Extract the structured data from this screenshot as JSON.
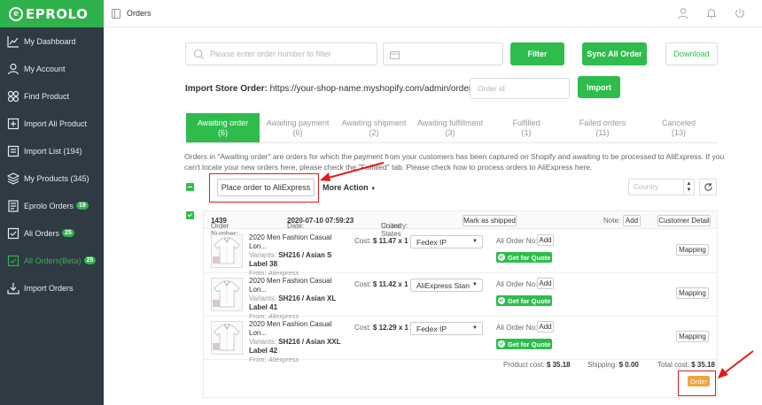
{
  "brand": {
    "logo_text": "EPROLO"
  },
  "header": {
    "title": "Orders"
  },
  "sidebar": {
    "items": [
      {
        "label": "My Dashboard",
        "icon": "chart-icon"
      },
      {
        "label": "My Account",
        "icon": "user-icon"
      },
      {
        "label": "Find Product",
        "icon": "grid-icon"
      },
      {
        "label": "Import Ali Product",
        "icon": "import-icon"
      },
      {
        "label": "Import List (194)",
        "icon": "list-icon"
      },
      {
        "label": "My Products (345)",
        "icon": "layers-icon"
      },
      {
        "label": "Eprolo Orders",
        "badge": "19",
        "icon": "document-icon"
      },
      {
        "label": "Ali Orders",
        "badge": "25",
        "icon": "checkbox-icon"
      },
      {
        "label": "All Orders(Beta)",
        "badge": "25",
        "icon": "checkbox-icon",
        "active": true
      },
      {
        "label": "Import Orders",
        "icon": "download-icon"
      }
    ]
  },
  "filters": {
    "order_search_placeholder": "Please enter order number to filter",
    "filter_label": "Filter",
    "sync_label": "Sync All Order",
    "download_label": "Download"
  },
  "import_store": {
    "label": "Import Store Order:",
    "url": "https://your-shop-name.myshopify.com/admin/orders/",
    "order_id_placeholder": "Order id",
    "import_label": "Import"
  },
  "tabs": [
    {
      "label": "Awaiting order",
      "count": "(6)",
      "active": true
    },
    {
      "label": "Awaiting payment",
      "count": "(6)"
    },
    {
      "label": "Awaiting shipment",
      "count": "(2)"
    },
    {
      "label": "Awaiting fulfillment",
      "count": "(3)"
    },
    {
      "label": "Fulfilled",
      "count": "(1)"
    },
    {
      "label": "Failed orders",
      "count": "(11)"
    },
    {
      "label": "Canceled",
      "count": "(13)"
    }
  ],
  "info_text": "Orders in \"Awaiting order\" are orders for which the payment from your customers has been captured on Shopify and awaiting to be processed to AliExpress. If you can't locate your new orders here, please check the \"Fulfilled\" tab. Please check how to process orders to AliExpress here.",
  "actions": {
    "place_order_label": "Place order to AliExpress",
    "more_action_label": "More Action",
    "country_placeholder": "Country"
  },
  "order": {
    "number_label": "Order Number:",
    "number": "1439",
    "date_label": "Date:",
    "date": "2020-07-10 07:59:23",
    "country_label": "Country:",
    "country": "United States",
    "mark_shipped_label": "Mark as shipped",
    "note_label": "Note:",
    "add_label": "Add",
    "customer_detail_label": "Customer Detail",
    "items": [
      {
        "name": "2020 Men Fashion Casual Lon...",
        "variants_label": "Variants:",
        "variants": "SH216 / Asian S Label 38",
        "from_label": "From:",
        "from": "Aliexpress",
        "cost_label": "Cost:",
        "cost": "$ 11.47",
        "qty": "x 1",
        "shipping": "Fedex IP",
        "ali_order_label": "Ali Order No:",
        "add_label": "Add",
        "quote_label": "Get for Quote",
        "mapping_label": "Mapping"
      },
      {
        "name": "2020 Men Fashion Casual Lon...",
        "variants_label": "Variants:",
        "variants": "SH216 / Asian XL Label 41",
        "from_label": "From:",
        "from": "Aliexpress",
        "cost_label": "Cost:",
        "cost": "$ 11.42",
        "qty": "x 1",
        "shipping": "AliExpress Stan",
        "ali_order_label": "Ali Order No:",
        "add_label": "Add",
        "quote_label": "Get for Quote",
        "mapping_label": "Mapping"
      },
      {
        "name": "2020 Men Fashion Casual Lon...",
        "variants_label": "Variants:",
        "variants": "SH216 / Asian XXL Label 42",
        "from_label": "From:",
        "from": "Aliexpress",
        "cost_label": "Cost:",
        "cost": "$ 12.29",
        "qty": "x 1",
        "shipping": "Fedex IP",
        "ali_order_label": "Ali Order No:",
        "add_label": "Add",
        "quote_label": "Get for Quote",
        "mapping_label": "Mapping"
      }
    ],
    "product_cost_label": "Product cost:",
    "product_cost": "$ 35.18",
    "shipping_label": "Shipping:",
    "shipping_cost": "$ 0.00",
    "total_cost_label": "Total cost:",
    "total_cost": "$ 35.18",
    "order_button_label": "Order"
  },
  "colors": {
    "accent": "#2ebd4d",
    "sidebar_bg": "#2f3a42",
    "highlight": "#e21b1b",
    "order_button": "#f2a33b"
  }
}
